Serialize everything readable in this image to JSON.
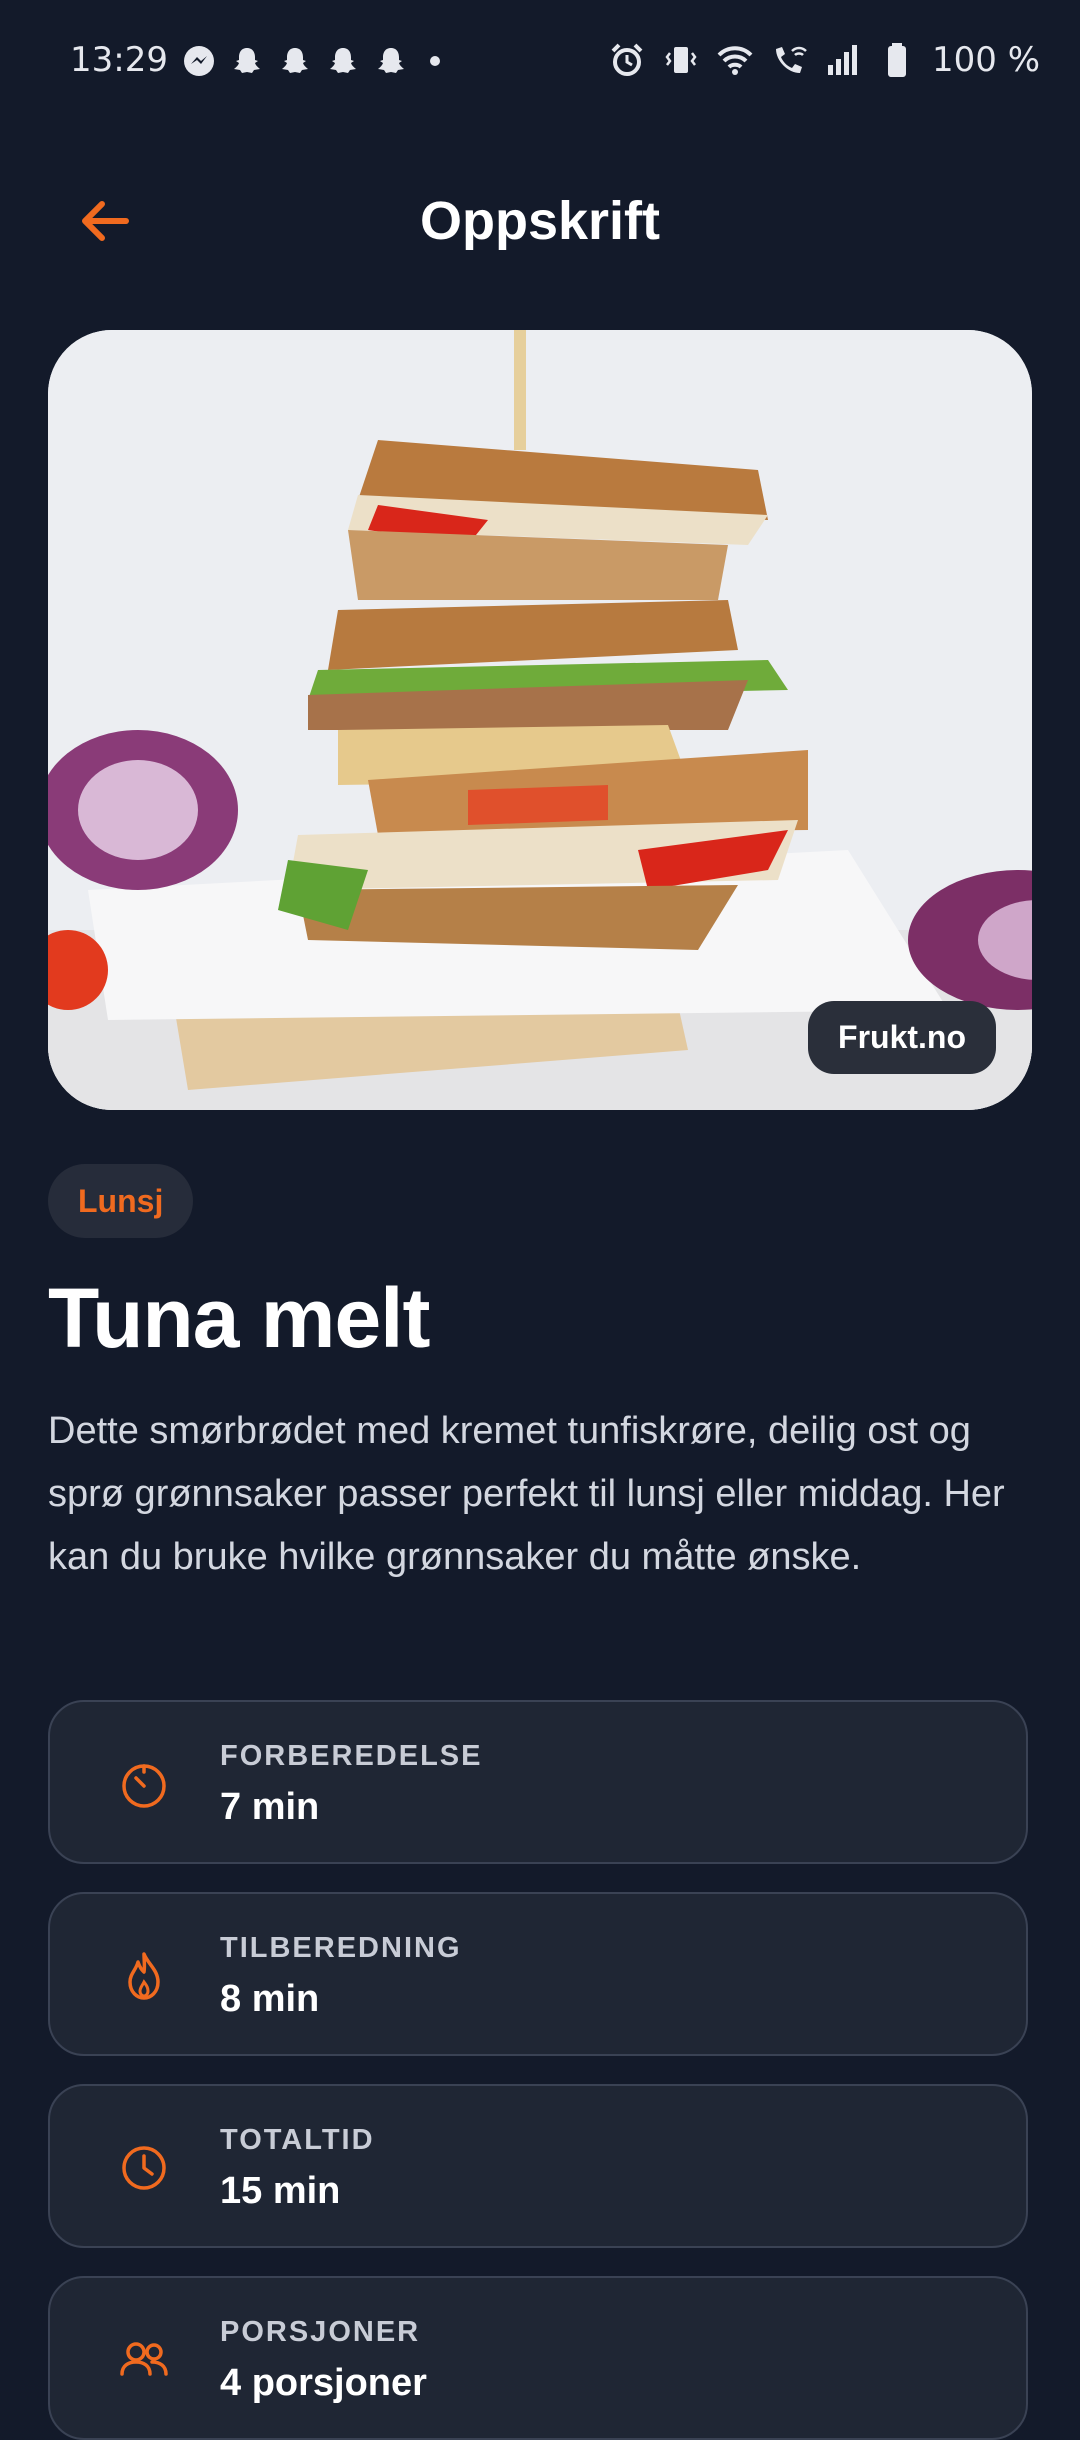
{
  "status_bar": {
    "time": "13:29",
    "battery": "100 %",
    "notification_icons": [
      "messenger-icon",
      "snapchat-icon",
      "snapchat-icon",
      "snapchat-icon",
      "snapchat-icon"
    ],
    "system_icons": [
      "alarm-icon",
      "vibrate-icon",
      "wifi-icon",
      "wifi-calling-icon",
      "signal-icon",
      "battery-icon"
    ]
  },
  "header": {
    "title": "Oppskrift",
    "back_icon": "arrow-left-icon"
  },
  "hero": {
    "source": "Frukt.no"
  },
  "recipe": {
    "category": "Lunsj",
    "title": "Tuna melt",
    "description": "Dette smørbrødet med kremet tunfiskrøre, deilig ost og sprø grønnsaker passer perfekt til lunsj eller middag. Her kan du bruke hvilke grønnsaker du måtte ønske."
  },
  "info": [
    {
      "label": "FORBEREDELSE",
      "value": "7 min",
      "icon": "timer-icon"
    },
    {
      "label": "TILBEREDNING",
      "value": "8 min",
      "icon": "flame-icon"
    },
    {
      "label": "TOTALTID",
      "value": "15 min",
      "icon": "clock-icon"
    },
    {
      "label": "PORSJONER",
      "value": "4 porsjoner",
      "icon": "people-icon"
    }
  ],
  "colors": {
    "background": "#131a2a",
    "accent": "#f06a1f",
    "card": "#1f2634"
  }
}
